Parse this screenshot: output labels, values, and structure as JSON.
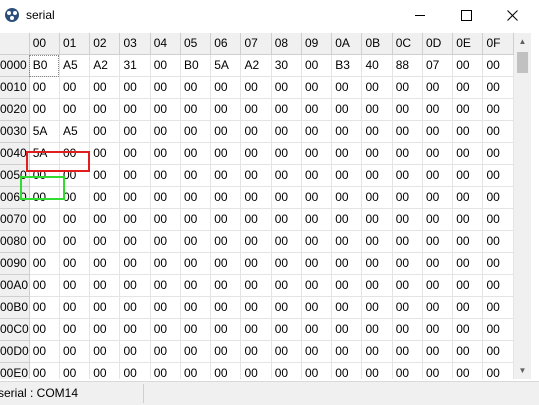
{
  "window": {
    "title": "serial"
  },
  "grid": {
    "columns": [
      "00",
      "01",
      "02",
      "03",
      "04",
      "05",
      "06",
      "07",
      "08",
      "09",
      "0A",
      "0B",
      "0C",
      "0D",
      "0E",
      "0F"
    ],
    "rows": [
      {
        "addr": "0000",
        "cells": [
          "B0",
          "A5",
          "A2",
          "31",
          "00",
          "B0",
          "5A",
          "A2",
          "30",
          "00",
          "B3",
          "40",
          "88",
          "07",
          "00",
          "00"
        ]
      },
      {
        "addr": "0010",
        "cells": [
          "00",
          "00",
          "00",
          "00",
          "00",
          "00",
          "00",
          "00",
          "00",
          "00",
          "00",
          "00",
          "00",
          "00",
          "00",
          "00"
        ]
      },
      {
        "addr": "0020",
        "cells": [
          "00",
          "00",
          "00",
          "00",
          "00",
          "00",
          "00",
          "00",
          "00",
          "00",
          "00",
          "00",
          "00",
          "00",
          "00",
          "00"
        ]
      },
      {
        "addr": "0030",
        "cells": [
          "5A",
          "A5",
          "00",
          "00",
          "00",
          "00",
          "00",
          "00",
          "00",
          "00",
          "00",
          "00",
          "00",
          "00",
          "00",
          "00"
        ]
      },
      {
        "addr": "0040",
        "cells": [
          "5A",
          "00",
          "00",
          "00",
          "00",
          "00",
          "00",
          "00",
          "00",
          "00",
          "00",
          "00",
          "00",
          "00",
          "00",
          "00"
        ]
      },
      {
        "addr": "0050",
        "cells": [
          "00",
          "00",
          "00",
          "00",
          "00",
          "00",
          "00",
          "00",
          "00",
          "00",
          "00",
          "00",
          "00",
          "00",
          "00",
          "00"
        ]
      },
      {
        "addr": "0060",
        "cells": [
          "00",
          "00",
          "00",
          "00",
          "00",
          "00",
          "00",
          "00",
          "00",
          "00",
          "00",
          "00",
          "00",
          "00",
          "00",
          "00"
        ]
      },
      {
        "addr": "0070",
        "cells": [
          "00",
          "00",
          "00",
          "00",
          "00",
          "00",
          "00",
          "00",
          "00",
          "00",
          "00",
          "00",
          "00",
          "00",
          "00",
          "00"
        ]
      },
      {
        "addr": "0080",
        "cells": [
          "00",
          "00",
          "00",
          "00",
          "00",
          "00",
          "00",
          "00",
          "00",
          "00",
          "00",
          "00",
          "00",
          "00",
          "00",
          "00"
        ]
      },
      {
        "addr": "0090",
        "cells": [
          "00",
          "00",
          "00",
          "00",
          "00",
          "00",
          "00",
          "00",
          "00",
          "00",
          "00",
          "00",
          "00",
          "00",
          "00",
          "00"
        ]
      },
      {
        "addr": "00A0",
        "cells": [
          "00",
          "00",
          "00",
          "00",
          "00",
          "00",
          "00",
          "00",
          "00",
          "00",
          "00",
          "00",
          "00",
          "00",
          "00",
          "00"
        ]
      },
      {
        "addr": "00B0",
        "cells": [
          "00",
          "00",
          "00",
          "00",
          "00",
          "00",
          "00",
          "00",
          "00",
          "00",
          "00",
          "00",
          "00",
          "00",
          "00",
          "00"
        ]
      },
      {
        "addr": "00C0",
        "cells": [
          "00",
          "00",
          "00",
          "00",
          "00",
          "00",
          "00",
          "00",
          "00",
          "00",
          "00",
          "00",
          "00",
          "00",
          "00",
          "00"
        ]
      },
      {
        "addr": "00D0",
        "cells": [
          "00",
          "00",
          "00",
          "00",
          "00",
          "00",
          "00",
          "00",
          "00",
          "00",
          "00",
          "00",
          "00",
          "00",
          "00",
          "00"
        ]
      },
      {
        "addr": "00E0",
        "cells": [
          "00",
          "00",
          "00",
          "00",
          "00",
          "00",
          "00",
          "00",
          "00",
          "00",
          "00",
          "00",
          "00",
          "00",
          "00",
          "00"
        ]
      }
    ]
  },
  "status": {
    "text": "serial : COM14"
  },
  "highlights": {
    "red_color": "#e21d1d",
    "green_color": "#2fdc2f"
  },
  "icons": {
    "app": "serial-app-icon",
    "minimize": "minimize-icon",
    "maximize": "maximize-icon",
    "close": "close-icon"
  }
}
